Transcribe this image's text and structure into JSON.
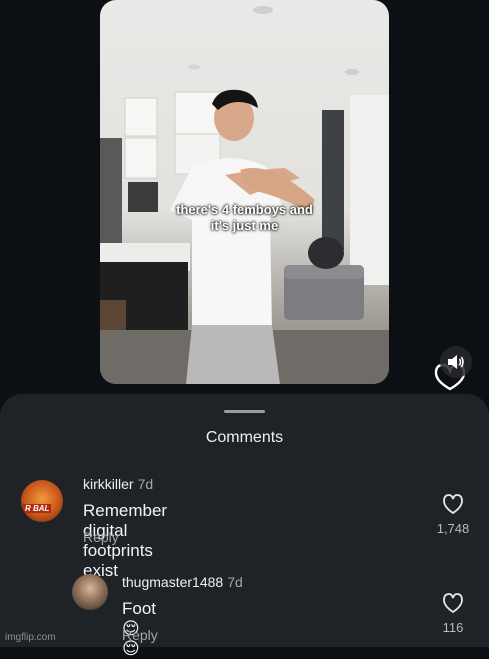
{
  "video": {
    "caption_line1": "there's 4 femboys and",
    "caption_line2": "it's just me",
    "sound_icon": "speaker-volume-icon"
  },
  "sheet": {
    "title": "Comments"
  },
  "comments": [
    {
      "username": "kirkkiller",
      "age": "7d",
      "text": "Remember digital footprints exist",
      "reply_label": "Reply",
      "likes": "1,748",
      "avatar_badge": "R BAL"
    },
    {
      "username": "thugmaster1488",
      "age": "7d",
      "text": "Foot 😌😌",
      "reply_label": "Reply",
      "likes": "116"
    }
  ],
  "watermark": "imgflip.com"
}
